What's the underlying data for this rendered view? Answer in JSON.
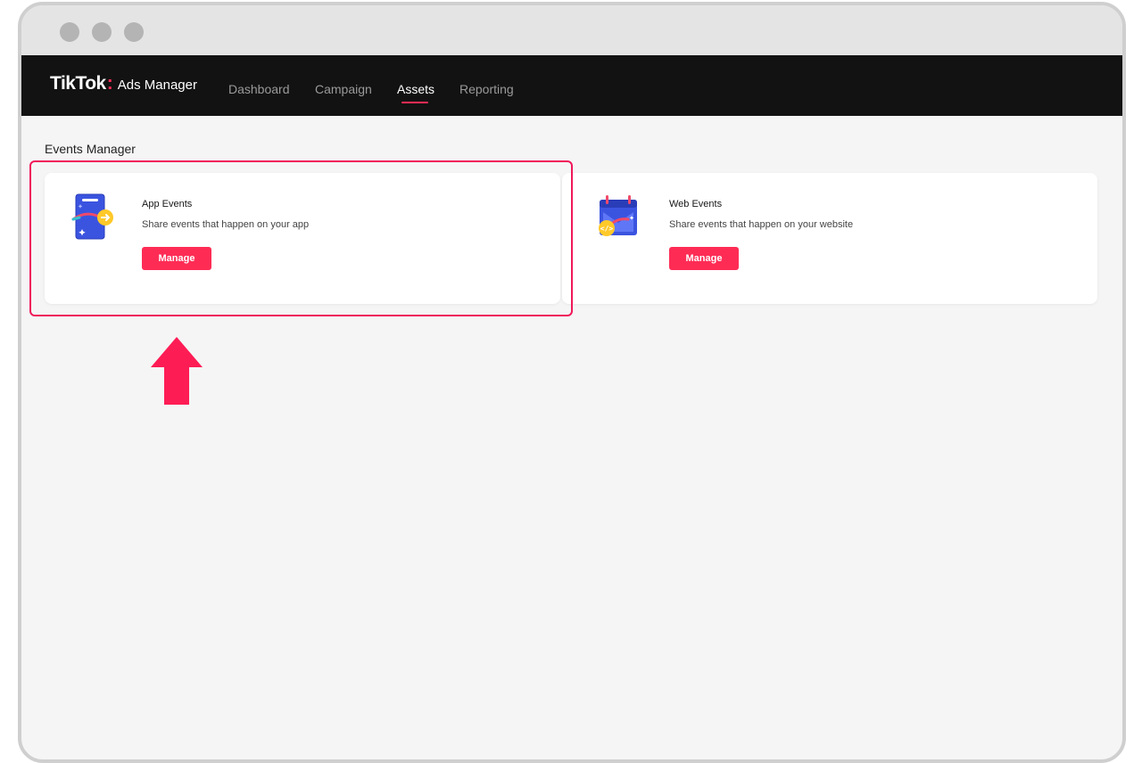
{
  "app": {
    "brand_name": "TikTok",
    "brand_colon": ":",
    "brand_sub": "Ads Manager"
  },
  "nav": {
    "items": [
      {
        "label": "Dashboard",
        "active": false
      },
      {
        "label": "Campaign",
        "active": false
      },
      {
        "label": "Assets",
        "active": true
      },
      {
        "label": "Reporting",
        "active": false
      }
    ]
  },
  "page": {
    "title": "Events Manager"
  },
  "cards": [
    {
      "title": "App Events",
      "description": "Share events that happen on your app",
      "button_label": "Manage",
      "icon": "app-events-icon"
    },
    {
      "title": "Web Events",
      "description": "Share events that happen on your website",
      "button_label": "Manage",
      "icon": "web-events-icon"
    }
  ],
  "annotations": {
    "highlight_color": "#f0185a",
    "arrow_icon": "up-arrow-icon"
  },
  "colors": {
    "accent": "#fe2c55",
    "nav_background": "#121212",
    "page_background": "#f5f5f5"
  }
}
